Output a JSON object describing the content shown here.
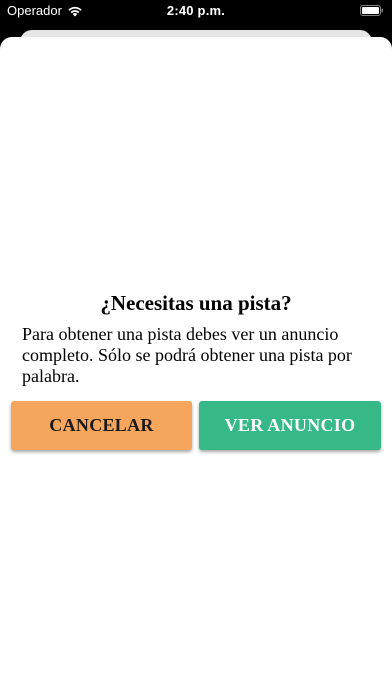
{
  "status_bar": {
    "carrier": "Operador",
    "time": "2:40 p.m.",
    "icons": [
      "wifi-icon",
      "battery-icon"
    ]
  },
  "dialog": {
    "title": "¿Necesitas una pista?",
    "message": "Para obtener una pista debes ver un anuncio completo. Sólo se podrá obtener una pista por palabra.",
    "cancel_label": "CANCELAR",
    "watch_ad_label": "VER ANUNCIO"
  },
  "colors": {
    "cancel_button": "#f5a55c",
    "watch_ad_button": "#36b887",
    "sheet_background": "#ffffff",
    "backdrop": "#000000"
  }
}
